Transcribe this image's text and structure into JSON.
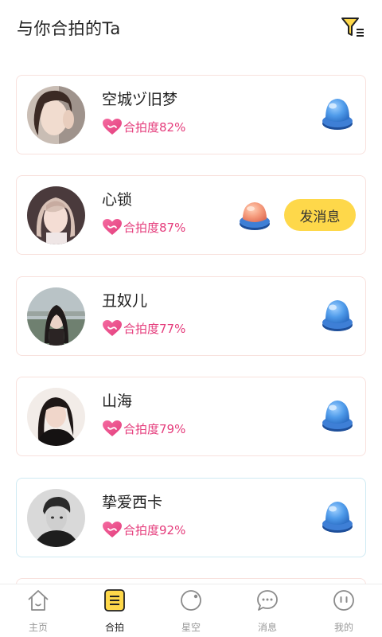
{
  "header": {
    "title": "与你合拍的Ta",
    "filter_icon": "filter-icon"
  },
  "cards": [
    {
      "name": "空城ヅ旧梦",
      "match": "合拍度82%",
      "button_icon": "blue-push-button-icon",
      "border": "pink"
    },
    {
      "name": "心锁",
      "match": "合拍度87%",
      "button_icon": "peach-push-button-icon",
      "message_label": "发消息",
      "border": "pink"
    },
    {
      "name": "丑奴儿",
      "match": "合拍度77%",
      "button_icon": "blue-push-button-icon",
      "border": "pink"
    },
    {
      "name": "山海",
      "match": "合拍度79%",
      "button_icon": "blue-push-button-icon",
      "border": "pink"
    },
    {
      "name": "挚爱西卡",
      "match": "合拍度92%",
      "button_icon": "blue-push-button-icon",
      "border": "blue"
    }
  ],
  "tabbar": {
    "items": [
      {
        "label": "主页",
        "icon": "home-icon"
      },
      {
        "label": "合拍",
        "icon": "list-icon",
        "active": true
      },
      {
        "label": "星空",
        "icon": "planet-icon"
      },
      {
        "label": "消息",
        "icon": "chat-bubble-icon"
      },
      {
        "label": "我的",
        "icon": "face-icon"
      }
    ]
  },
  "colors": {
    "accent_pink": "#e53d7c",
    "message_button": "#fed84a",
    "blue_button": "#3a86d8",
    "peach_button": "#f08a6e",
    "active_tab": "#fed84a"
  }
}
